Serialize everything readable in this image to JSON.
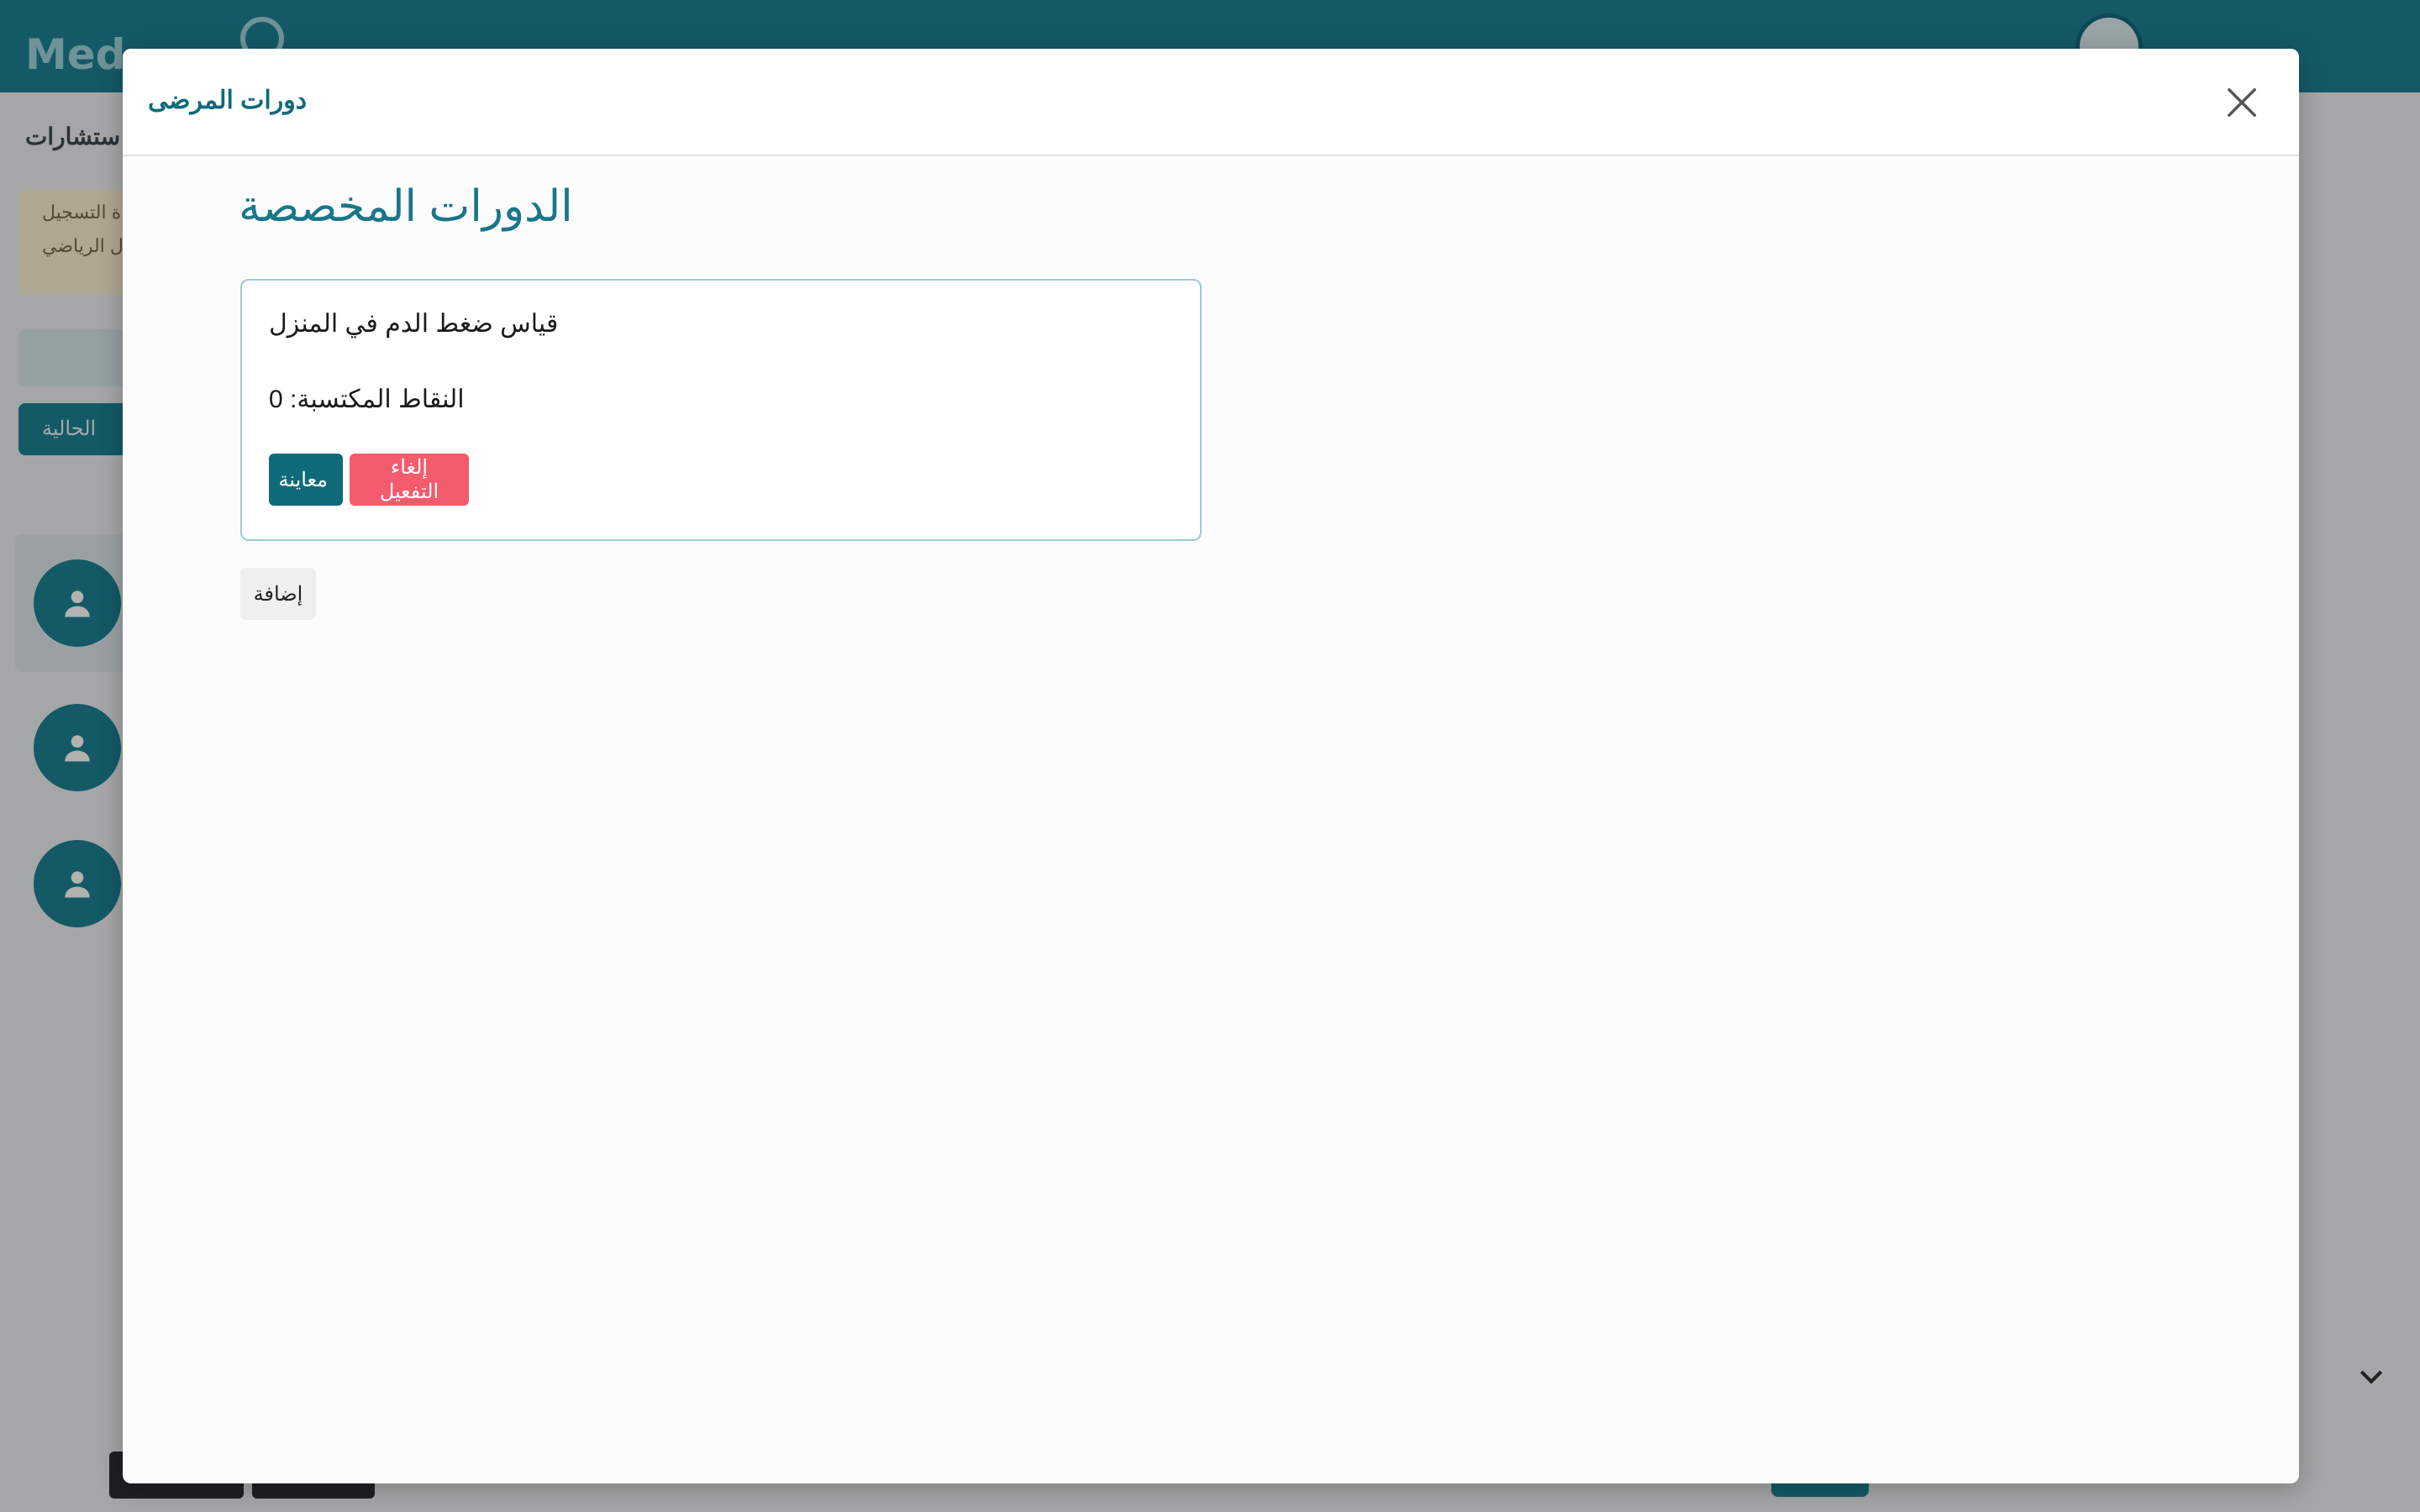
{
  "modal": {
    "title": "دورات المرضى",
    "section_title": "الدورات المخصصة",
    "courses": [
      {
        "name": "قياس ضغط الدم في المنزل",
        "points_text": "النقاط المكتسبة: 0",
        "preview_label": "معاينة",
        "deactivate_label": "إلغاء التفعيل"
      }
    ],
    "add_label": "إضافة"
  },
  "colors": {
    "primary": "#0f6a7a",
    "danger": "#f45b6c",
    "topbar": "#1c8293"
  },
  "icons": {
    "close": "close-icon",
    "avatar": "user-icon"
  }
}
